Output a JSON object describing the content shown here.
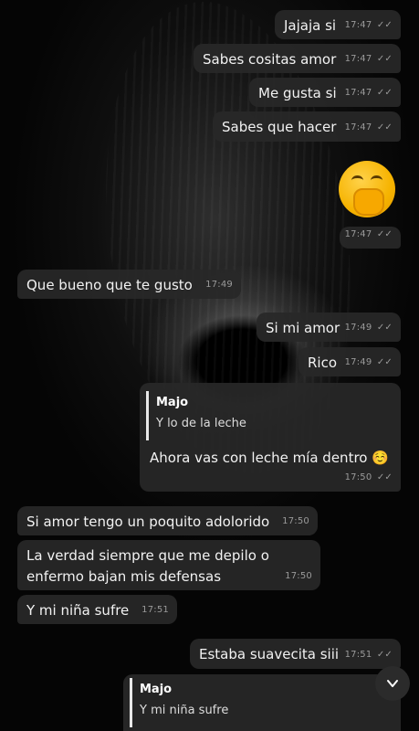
{
  "messages": [
    {
      "text": "Jajaja si",
      "time": "17:47",
      "ticks": "✓✓"
    },
    {
      "text": "Sabes cositas amor",
      "time": "17:47",
      "ticks": "✓✓"
    },
    {
      "text": "Me gusta si",
      "time": "17:47",
      "ticks": "✓✓"
    },
    {
      "text": "Sabes que hacer",
      "time": "17:47",
      "ticks": "✓✓"
    },
    {
      "text": "",
      "time": "17:47",
      "ticks": "✓✓",
      "emoji": "hand-over-mouth"
    },
    {
      "text": "Que bueno que te gusto",
      "time": "17:49"
    },
    {
      "text": "Si mi amor",
      "time": "17:49",
      "ticks": "✓✓"
    },
    {
      "text": "Rico",
      "time": "17:49",
      "ticks": "✓✓"
    },
    {
      "reply_name": "Majo",
      "reply_text": "Y lo de la leche",
      "text": "Ahora vas con leche mía dentro ☺️",
      "time": "17:50",
      "ticks": "✓✓"
    },
    {
      "text": "Si amor tengo un poquito adolorido",
      "time": "17:50"
    },
    {
      "text_line1": "La verdad siempre que me depilo o",
      "text_line2": "enfermo bajan mis defensas",
      "time": "17:50"
    },
    {
      "text": "Y mi niña sufre",
      "time": "17:51"
    },
    {
      "text": "Estaba suavecita siii",
      "time": "17:51",
      "ticks": "✓✓"
    },
    {
      "reply_name": "Majo",
      "reply_text": "Y mi niña sufre"
    }
  ],
  "scroll_button_icon": "chevron-down-icon",
  "colors": {
    "bubble": "#282828",
    "meta": "#9a9a9a",
    "reply_bar": "#e8e8e8"
  }
}
